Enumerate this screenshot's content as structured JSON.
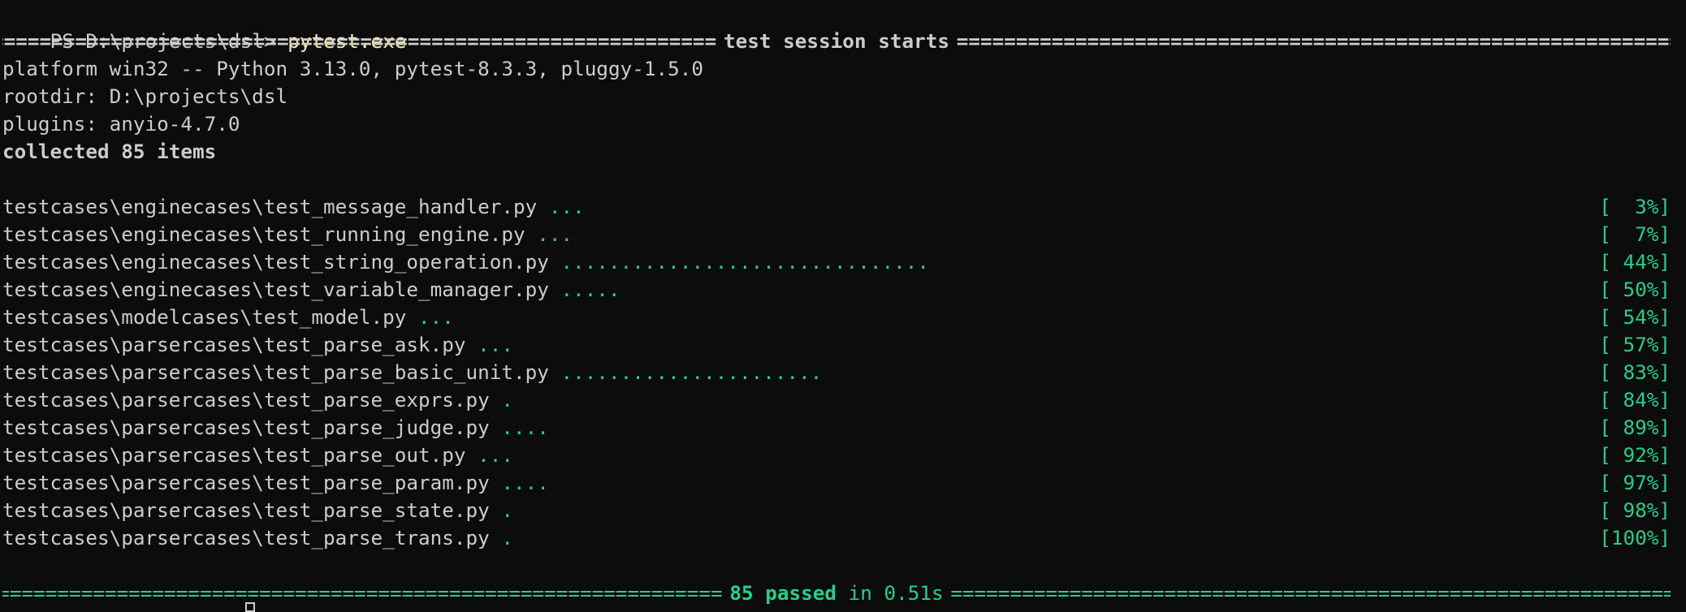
{
  "prompt": {
    "ps_path": "PS D:\\projects\\dsl> ",
    "command": "pytest.exe"
  },
  "session_header": {
    "title": "test session starts"
  },
  "info": {
    "platform": "platform win32 -- Python 3.13.0, pytest-8.3.3, pluggy-1.5.0",
    "rootdir": "rootdir: D:\\projects\\dsl",
    "plugins": "plugins: anyio-4.7.0",
    "collected": "collected 85 items"
  },
  "tests": [
    {
      "file": "testcases\\enginecases\\test_message_handler.py",
      "dots": "...",
      "pct": "[  3%]"
    },
    {
      "file": "testcases\\enginecases\\test_running_engine.py",
      "dots": "...",
      "pct": "[  7%]"
    },
    {
      "file": "testcases\\enginecases\\test_string_operation.py",
      "dots": "...............................",
      "pct": "[ 44%]"
    },
    {
      "file": "testcases\\enginecases\\test_variable_manager.py",
      "dots": ".....",
      "pct": "[ 50%]"
    },
    {
      "file": "testcases\\modelcases\\test_model.py",
      "dots": "...",
      "pct": "[ 54%]"
    },
    {
      "file": "testcases\\parsercases\\test_parse_ask.py",
      "dots": "...",
      "pct": "[ 57%]"
    },
    {
      "file": "testcases\\parsercases\\test_parse_basic_unit.py",
      "dots": "......................",
      "pct": "[ 83%]"
    },
    {
      "file": "testcases\\parsercases\\test_parse_exprs.py",
      "dots": ".",
      "pct": "[ 84%]"
    },
    {
      "file": "testcases\\parsercases\\test_parse_judge.py",
      "dots": "....",
      "pct": "[ 89%]"
    },
    {
      "file": "testcases\\parsercases\\test_parse_out.py",
      "dots": "...",
      "pct": "[ 92%]"
    },
    {
      "file": "testcases\\parsercases\\test_parse_param.py",
      "dots": "....",
      "pct": "[ 97%]"
    },
    {
      "file": "testcases\\parsercases\\test_parse_state.py",
      "dots": ".",
      "pct": "[ 98%]"
    },
    {
      "file": "testcases\\parsercases\\test_parse_trans.py",
      "dots": ".",
      "pct": "[100%]"
    }
  ],
  "summary": {
    "passed": "85 passed",
    "in_text": " in 0.51s"
  },
  "colors": {
    "background": "#0c0c0c",
    "foreground": "#cccccc",
    "command": "#f9f1a5",
    "success": "#23d18b"
  }
}
